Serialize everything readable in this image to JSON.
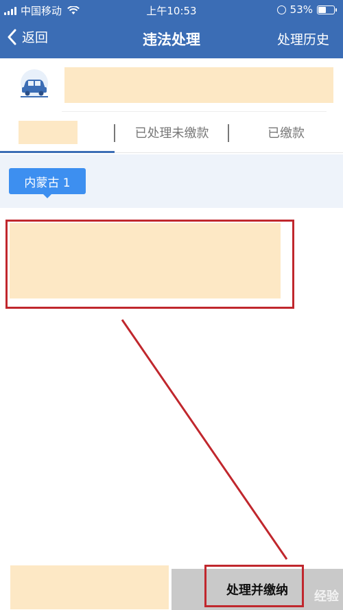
{
  "status_bar": {
    "carrier": "中国移动",
    "time": "上午10:53",
    "battery": "53%",
    "battery_level": 0.53
  },
  "nav": {
    "back_label": "返回",
    "title": "违法处理",
    "history_label": "处理历史"
  },
  "tabs": [
    {
      "label": ""
    },
    {
      "label": "已处理未缴款"
    },
    {
      "label": "已缴款"
    }
  ],
  "region": {
    "badge_label": "内蒙古 1"
  },
  "bottom": {
    "pay_button_label": "处理并缴纳"
  },
  "watermark": "经验",
  "colors": {
    "header_bg": "#3b6db5",
    "accent": "#3d8ff0",
    "annotation": "#c0272d",
    "redaction": "#fde8c5"
  },
  "icons": [
    "back-icon",
    "car-icon",
    "wifi-icon",
    "signal-icon",
    "battery-icon",
    "rotation-lock-icon"
  ]
}
